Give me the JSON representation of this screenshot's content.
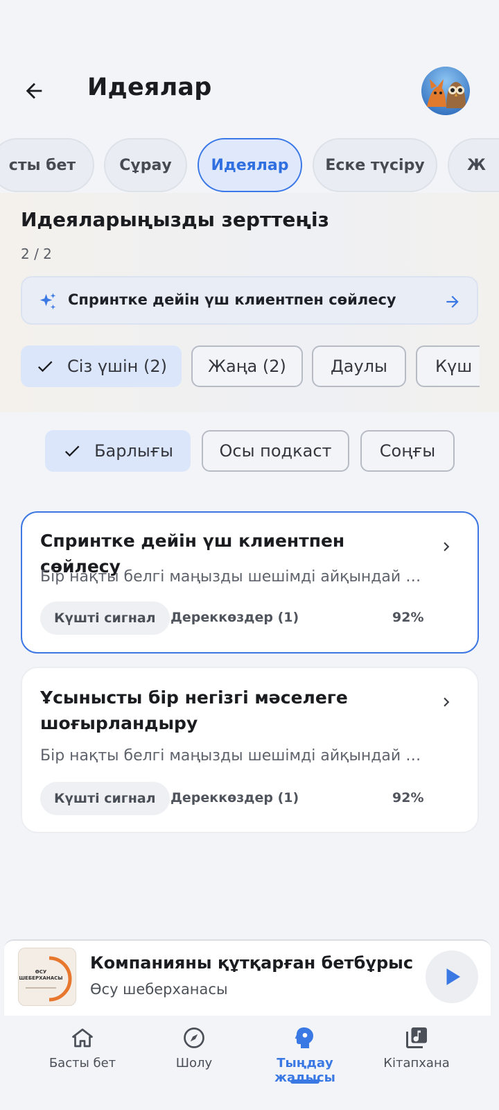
{
  "header": {
    "title": "Идеялар",
    "back_icon": "arrow-left-icon",
    "avatar_icon": "avatar-fox-owl"
  },
  "tabs": [
    {
      "label": "сты бет"
    },
    {
      "label": "Сұрау"
    },
    {
      "label": "Идеялар",
      "active": true
    },
    {
      "label": "Еске түсіру"
    },
    {
      "label": "Ж"
    }
  ],
  "hero": {
    "title": "Идеяларыңызды зерттеңіз",
    "count": "2 / 2",
    "suggestion": "Спринтке дейін үш клиентпен сөйлесу",
    "suggestion_icon": "sparkle-icon",
    "arrow_icon": "arrow-right-icon"
  },
  "filters": [
    {
      "label": "Сіз үшін (2)",
      "selected": true
    },
    {
      "label": "Жаңа (2)"
    },
    {
      "label": "Даулы"
    },
    {
      "label": "Күш"
    }
  ],
  "scope": [
    {
      "label": "Барлығы",
      "selected": true
    },
    {
      "label": "Осы подкаст"
    },
    {
      "label": "Соңғы"
    }
  ],
  "cards": [
    {
      "title": "Спринтке дейін үш клиентпен сөйлесу",
      "desc": "Бір нақты белгі маңызды шешімді айқындай ал...",
      "badge": "Күшті сигнал",
      "sources": "Дереккөздер (1)",
      "pct": "92%"
    },
    {
      "title": "Ұсынысты бір негізгі мәселеге шоғырландыру",
      "desc": "Бір нақты белгі маңызды шешімді айқындай ал...",
      "badge": "Күшті сигнал",
      "sources": "Дереккөздер (1)",
      "pct": "92%"
    }
  ],
  "player": {
    "title": "Компанияны құтқарған бетбұрыс",
    "subtitle": "Өсу шеберханасы",
    "cover_text": "ӨСУ ШЕБЕРХАНАСЫ",
    "play_icon": "play-icon"
  },
  "nav": [
    {
      "label": "Басты бет",
      "icon": "home-icon"
    },
    {
      "label": "Шолу",
      "icon": "compass-icon"
    },
    {
      "label": "Тыңдау жадысы",
      "icon": "brain-head-icon",
      "active": true
    },
    {
      "label": "Кітапхана",
      "icon": "library-music-icon"
    }
  ],
  "colors": {
    "accent": "#3a78e3",
    "background": "#f2f4f8",
    "selected_chip": "#dbe6fb"
  }
}
